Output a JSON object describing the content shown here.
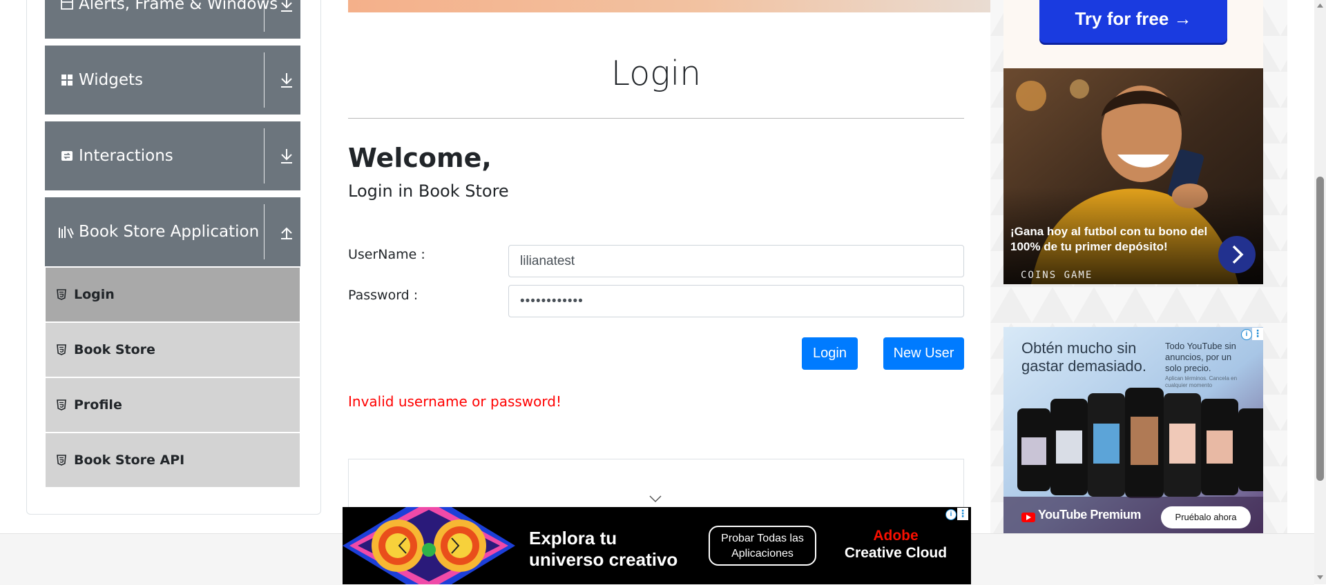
{
  "sidebar": {
    "groups": [
      {
        "label": "Alerts, Frame & Windows",
        "icon": "window-icon",
        "expanded": false
      },
      {
        "label": "Widgets",
        "icon": "widgets-icon",
        "expanded": false
      },
      {
        "label": "Interactions",
        "icon": "interactions-icon",
        "expanded": false
      },
      {
        "label": "Book Store Application",
        "icon": "books-icon",
        "expanded": true
      }
    ],
    "items": [
      {
        "label": "Login",
        "active": true
      },
      {
        "label": "Book Store",
        "active": false
      },
      {
        "label": "Profile",
        "active": false
      },
      {
        "label": "Book Store API",
        "active": false
      }
    ]
  },
  "main": {
    "title": "Login",
    "welcome": "Welcome,",
    "subheading": "Login in Book Store",
    "username": {
      "label": "UserName :",
      "value": "lilianatest"
    },
    "password": {
      "label": "Password :",
      "value": "••••••••••••"
    },
    "login_button": "Login",
    "new_user_button": "New User",
    "error_message": "Invalid username or password!"
  },
  "ads": {
    "top_cta": "Try for free →",
    "promo": {
      "caption": "¡Gana hoy al futbol con tu bono del 100% de tu primer depósito!",
      "brand": "COINS GAME"
    },
    "youtube": {
      "headline": "Obtén mucho sin gastar demasiado.",
      "subline": "Todo YouTube sin anuncios, por un solo precio.",
      "fineprint": "Aplican términos. Cancela en cualquier momento",
      "brand": "YouTube Premium",
      "cta": "Pruébalo ahora"
    },
    "bottom": {
      "headline": "Explora tu universo creativo",
      "cta": "Probar Todas las Aplicaciones",
      "brand_line1": "Adobe",
      "brand_line2": "Creative Cloud"
    }
  },
  "colors": {
    "sidebar_group": "#6c757d",
    "sidebar_item": "#d3d3d3",
    "sidebar_item_active": "#a9a9a9",
    "primary_button": "#007bff",
    "error": "#ff0000"
  }
}
